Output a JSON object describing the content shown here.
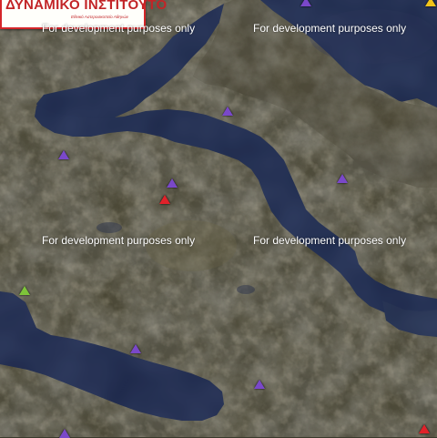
{
  "logo": {
    "title": "ΔΥΝΑΜΙΚΟ ΙΝΣΤΙΤΟΥΤΟ",
    "subtitle": "Εθνικό Αστεροσκοπείο Αθηνών"
  },
  "watermarks": [
    "For development purposes only",
    "For development purposes only",
    "For development purposes only",
    "For development purposes only"
  ],
  "colors": {
    "purple": "#7a48c9",
    "red": "#e0222a",
    "green": "#7ec43a",
    "yellow": "#f2c419",
    "sea": "#1f2b4a",
    "land": "#4a4634"
  },
  "station_icon": "triangle-marker-icon"
}
